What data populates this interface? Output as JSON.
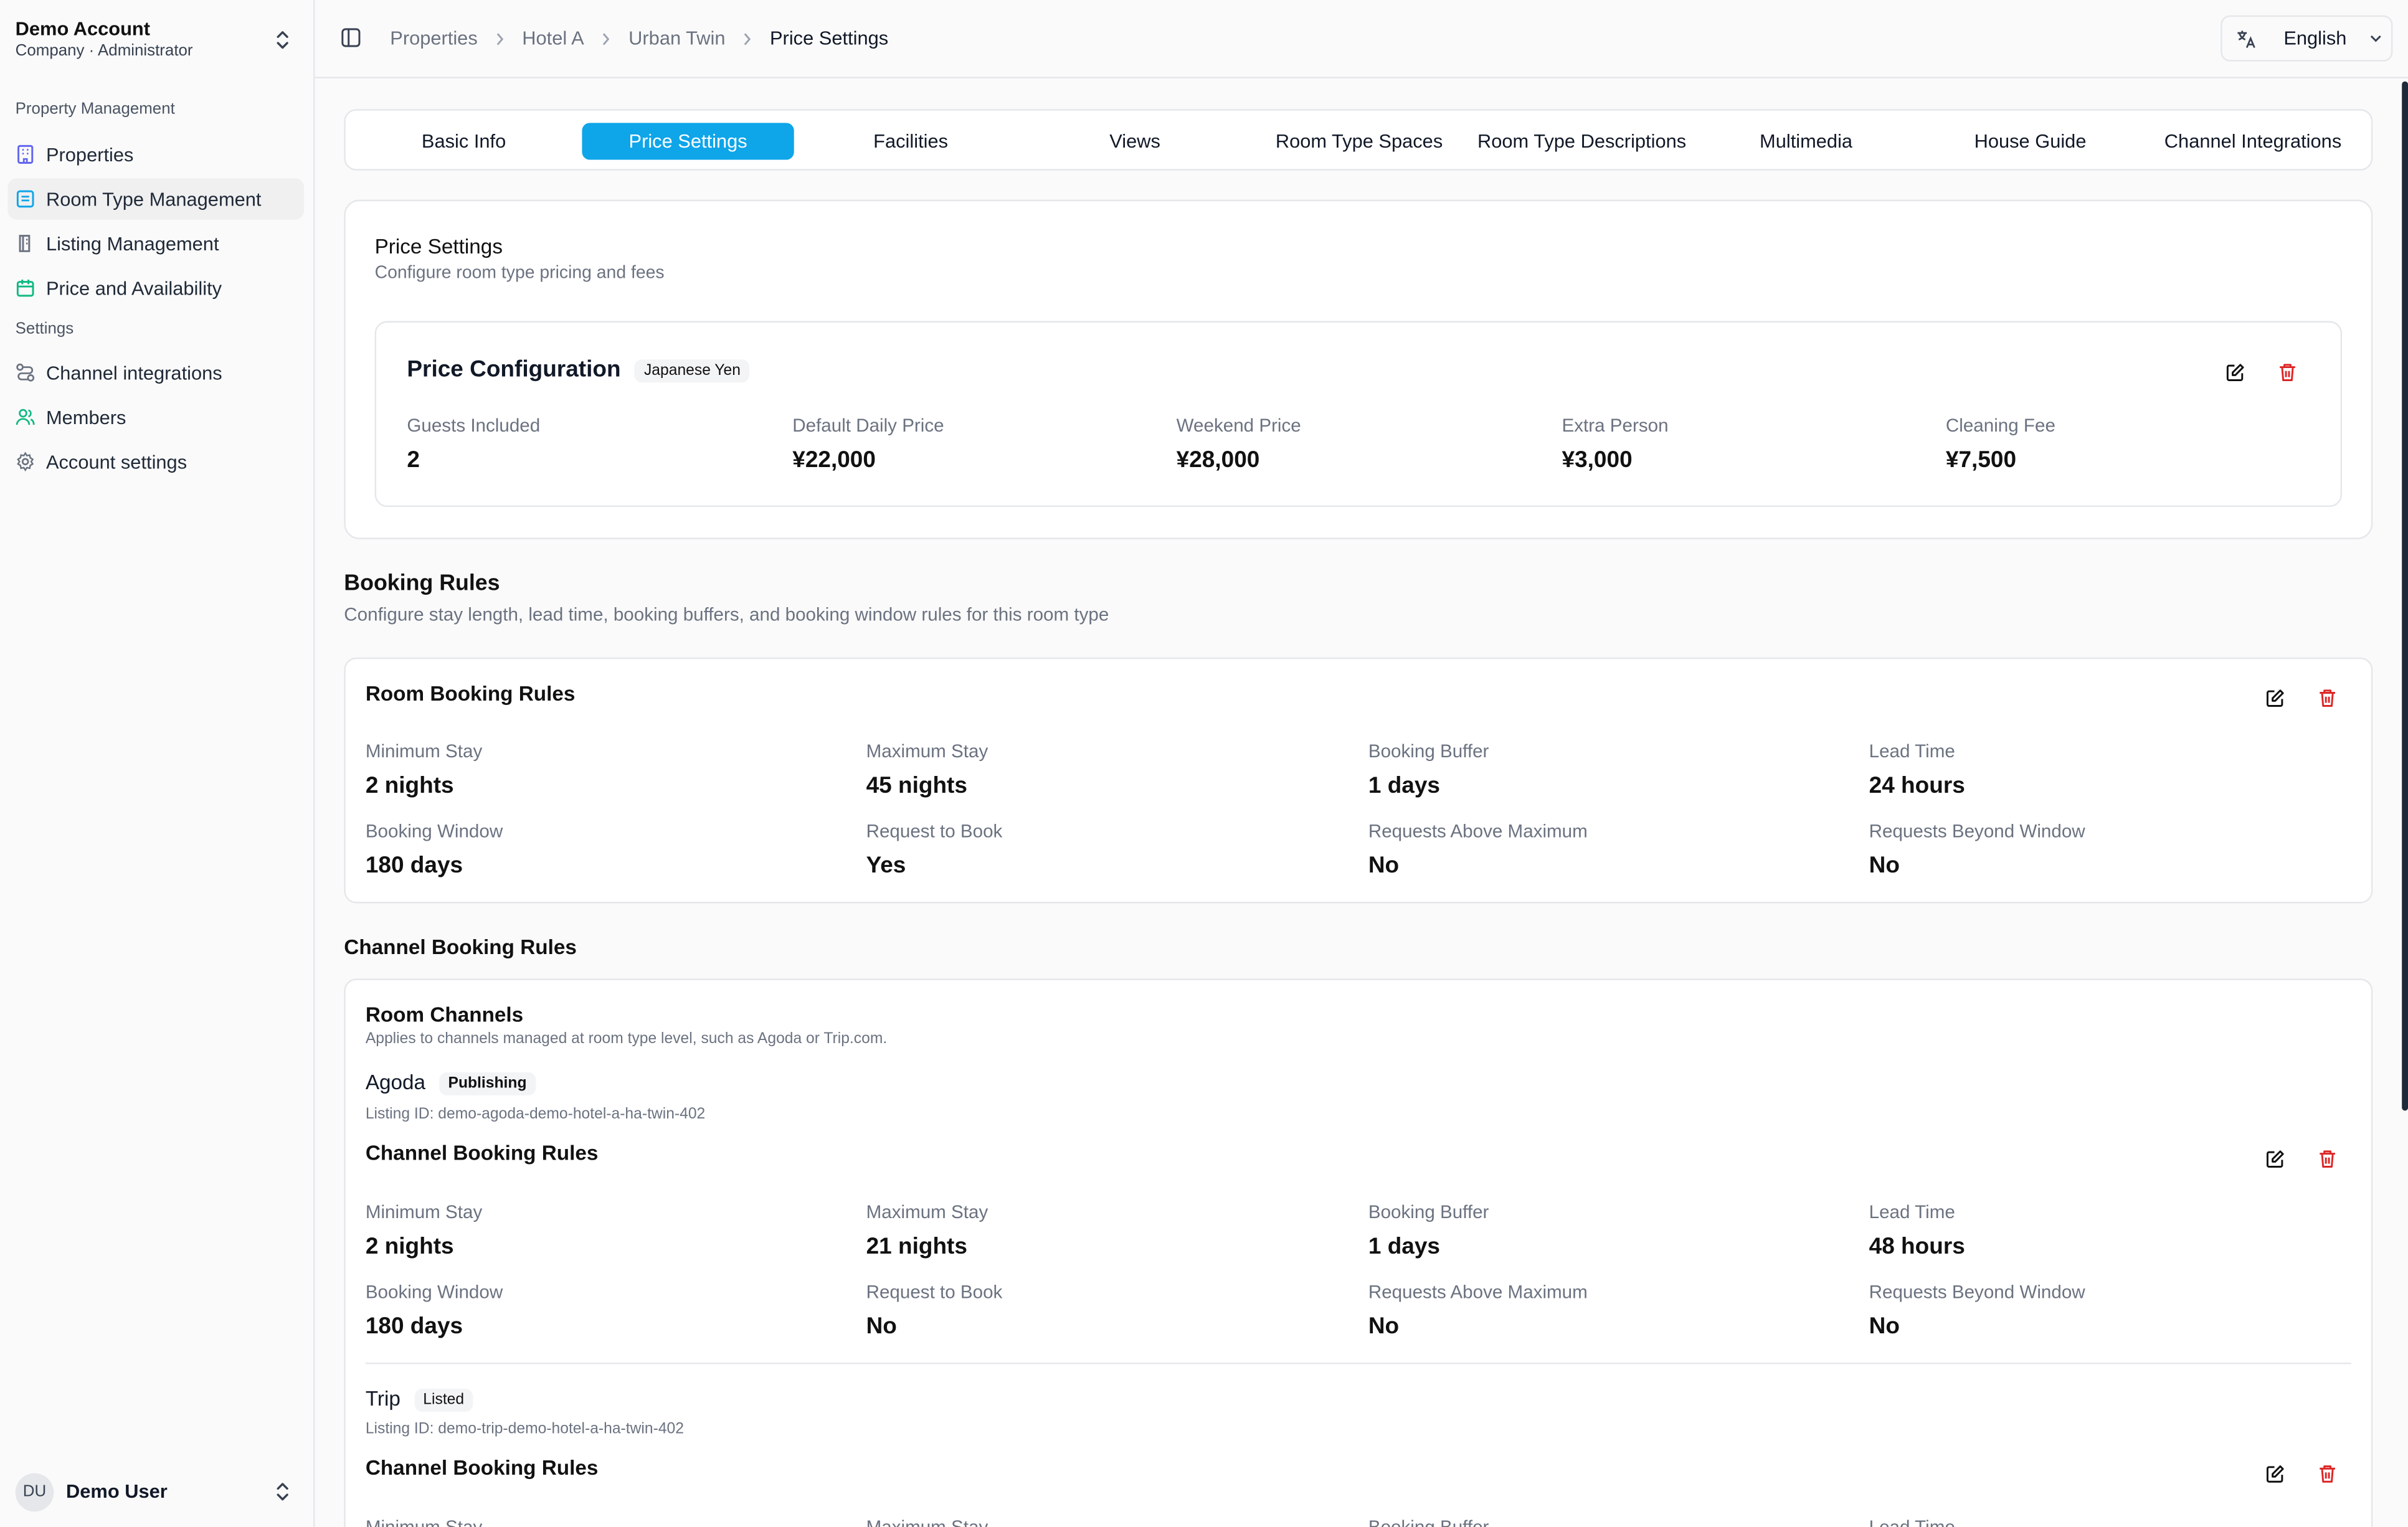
{
  "account": {
    "name": "Demo Account",
    "subtitle": "Company · Administrator"
  },
  "sidebar": {
    "section_property": "Property Management",
    "section_settings": "Settings",
    "items": [
      {
        "label": "Properties",
        "icon": "building-icon"
      },
      {
        "label": "Room Type Management",
        "icon": "hotel-icon"
      },
      {
        "label": "Listing Management",
        "icon": "listing-icon"
      },
      {
        "label": "Price and Availability",
        "icon": "calendar-icon"
      },
      {
        "label": "Channel integrations",
        "icon": "route-icon"
      },
      {
        "label": "Members",
        "icon": "users-icon"
      },
      {
        "label": "Account settings",
        "icon": "gear-icon"
      }
    ]
  },
  "user": {
    "initials": "DU",
    "name": "Demo User"
  },
  "breadcrumb": [
    "Properties",
    "Hotel A",
    "Urban Twin",
    "Price Settings"
  ],
  "language": "English",
  "tabs": [
    "Basic Info",
    "Price Settings",
    "Facilities",
    "Views",
    "Room Type Spaces",
    "Room Type Descriptions",
    "Multimedia",
    "House Guide",
    "Channel Integrations"
  ],
  "price_settings": {
    "title": "Price Settings",
    "subtitle": "Configure room type pricing and fees",
    "config_title": "Price Configuration",
    "currency": "Japanese Yen",
    "fields": [
      {
        "label": "Guests Included",
        "value": "2"
      },
      {
        "label": "Default Daily Price",
        "value": "¥22,000"
      },
      {
        "label": "Weekend Price",
        "value": "¥28,000"
      },
      {
        "label": "Extra Person",
        "value": "¥3,000"
      },
      {
        "label": "Cleaning Fee",
        "value": "¥7,500"
      }
    ]
  },
  "booking_rules": {
    "title": "Booking Rules",
    "subtitle": "Configure stay length, lead time, booking buffers, and booking window rules for this room type",
    "room_card_title": "Room Booking Rules",
    "room_fields": [
      {
        "label": "Minimum Stay",
        "value": "2 nights"
      },
      {
        "label": "Maximum Stay",
        "value": "45 nights"
      },
      {
        "label": "Booking Buffer",
        "value": "1 days"
      },
      {
        "label": "Lead Time",
        "value": "24 hours"
      },
      {
        "label": "Booking Window",
        "value": "180 days"
      },
      {
        "label": "Request to Book",
        "value": "Yes"
      },
      {
        "label": "Requests Above Maximum",
        "value": "No"
      },
      {
        "label": "Requests Beyond Window",
        "value": "No"
      }
    ]
  },
  "channel_rules": {
    "title": "Channel Booking Rules",
    "room_channels_title": "Room Channels",
    "room_channels_sub": "Applies to channels managed at room type level, such as Agoda or Trip.com.",
    "channels": [
      {
        "name": "Agoda",
        "status": "Publishing",
        "listing_id": "Listing ID: demo-agoda-demo-hotel-a-ha-twin-402",
        "rules_title": "Channel Booking Rules",
        "fields": [
          {
            "label": "Minimum Stay",
            "value": "2 nights"
          },
          {
            "label": "Maximum Stay",
            "value": "21 nights"
          },
          {
            "label": "Booking Buffer",
            "value": "1 days"
          },
          {
            "label": "Lead Time",
            "value": "48 hours"
          },
          {
            "label": "Booking Window",
            "value": "180 days"
          },
          {
            "label": "Request to Book",
            "value": "No"
          },
          {
            "label": "Requests Above Maximum",
            "value": "No"
          },
          {
            "label": "Requests Beyond Window",
            "value": "No"
          }
        ]
      },
      {
        "name": "Trip",
        "status": "Listed",
        "listing_id": "Listing ID: demo-trip-demo-hotel-a-ha-twin-402",
        "rules_title": "Channel Booking Rules",
        "fields": [
          {
            "label": "Minimum Stay"
          },
          {
            "label": "Maximum Stay"
          },
          {
            "label": "Booking Buffer"
          },
          {
            "label": "Lead Time"
          }
        ]
      }
    ]
  },
  "colors": {
    "accent": "#0ea5e9",
    "danger": "#dc2626"
  }
}
